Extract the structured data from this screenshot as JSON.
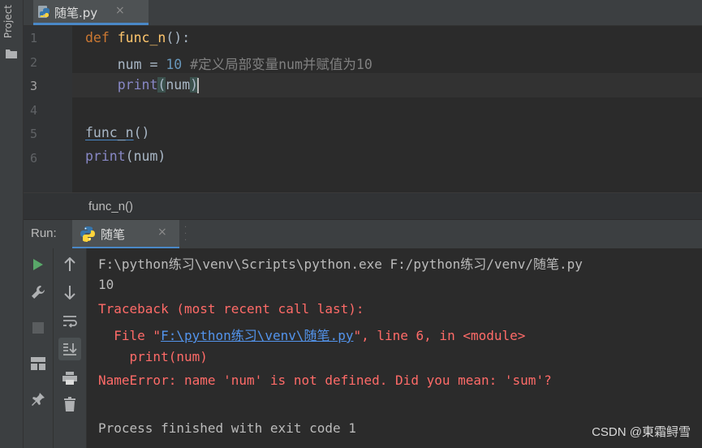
{
  "project_strip": {
    "label": "Project"
  },
  "editor_tab": {
    "filename": "随笔.py",
    "close_symbol": "×"
  },
  "gutter": {
    "line_numbers": [
      "1",
      "2",
      "3",
      "4",
      "5",
      "6"
    ]
  },
  "code": {
    "line1": {
      "kw": "def",
      "fn_name": "func_n",
      "rest": "():"
    },
    "line2": {
      "indent": "    ",
      "var": "num",
      "op": " = ",
      "value": "10",
      "comment": " #定义局部变量num并赋值为10"
    },
    "line3": {
      "indent": "    ",
      "builtin": "print",
      "open": "(",
      "arg": "num",
      "close": ")"
    },
    "line5": {
      "call": "func_n",
      "rest": "()"
    },
    "line6": {
      "builtin": "print",
      "rest": "(num)"
    }
  },
  "breadcrumb": {
    "text": "func_n()"
  },
  "run_panel": {
    "label": "Run:",
    "tab_label": "随笔",
    "close_symbol": "×"
  },
  "console": {
    "cmd": "F:\\python练习\\venv\\Scripts\\python.exe F:/python练习/venv/随笔.py",
    "output1": "10",
    "traceback_header": "Traceback (most recent call last):",
    "file_prefix": "  File \"",
    "file_link": "F:\\python练习\\venv\\随笔.py",
    "file_suffix": "\", line 6, in <module>",
    "code_line": "    print(num)",
    "error": "NameError: name 'num' is not defined. Did you mean: 'sum'?",
    "exit": "Process finished with exit code 1"
  },
  "watermark": "CSDN @東霜鲟雪",
  "colors": {
    "accent": "#4a88c7",
    "error": "#ff6b68",
    "run_green": "#59a869"
  },
  "icons": {
    "strip": [
      "folder-icon"
    ],
    "toolbar1": [
      "run-icon",
      "wrench-icon",
      "stop-icon",
      "layout-icon",
      "pin-icon"
    ],
    "toolbar2": [
      "arrow-up-icon",
      "arrow-down-icon",
      "soft-wrap-icon",
      "scroll-to-end-icon",
      "print-icon",
      "trash-icon"
    ]
  }
}
